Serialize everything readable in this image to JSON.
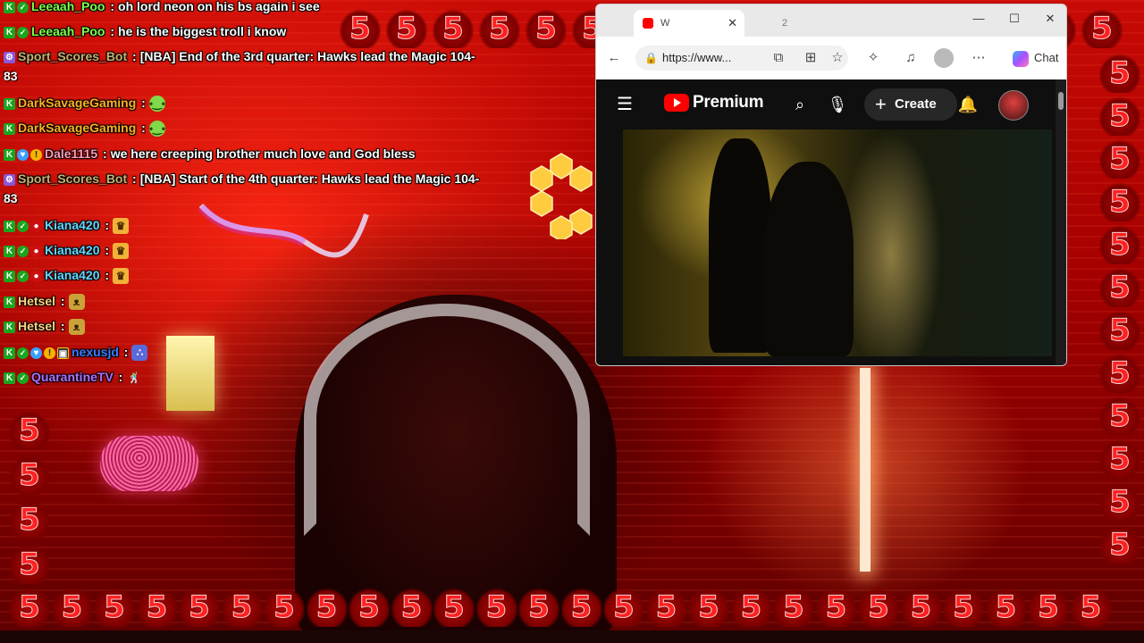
{
  "stream": {
    "border_glyph": "5",
    "chat": [
      {
        "badges": [
          "k-badge",
          "check-badge"
        ],
        "user": "Leeaah_Poo",
        "user_color": "#7dff4a",
        "text": "oh lord neon on his bs again i see"
      },
      {
        "badges": [
          "k-badge",
          "check-badge"
        ],
        "user": "Leeaah_Poo",
        "user_color": "#7dff4a",
        "text": "he is the biggest troll i know"
      },
      {
        "badges": [
          "bot-badge"
        ],
        "user": "Sport_Scores_Bot",
        "user_color": "#c8b070",
        "text": "[NBA] End of the 3rd quarter: Hawks lead the Magic 104-",
        "cont": "83"
      },
      {
        "badges": [
          "k-badge"
        ],
        "user": "DarkSavageGaming",
        "user_color": "#ffb020",
        "emote": "slime-emote"
      },
      {
        "badges": [
          "k-badge"
        ],
        "user": "DarkSavageGaming",
        "user_color": "#ffb020",
        "emote": "slime-emote"
      },
      {
        "badges": [
          "k-badge",
          "heart-badge",
          "gold-badge"
        ],
        "user": "Dale1115",
        "user_color": "#ff9ab8",
        "text": "we here creeping brother much love and God bless"
      },
      {
        "badges": [
          "bot-badge"
        ],
        "user": "Sport_Scores_Bot",
        "user_color": "#c8b070",
        "text": "[NBA] Start of the 4th quarter: Hawks lead the Magic 104-",
        "cont": "83"
      },
      {
        "badges": [
          "k-badge",
          "check-badge",
          "red-badge"
        ],
        "user": "Kiana420",
        "user_color": "#60d8ff",
        "emote": "crown-emote"
      },
      {
        "badges": [
          "k-badge",
          "check-badge",
          "red-badge"
        ],
        "user": "Kiana420",
        "user_color": "#60d8ff",
        "emote": "crown-emote"
      },
      {
        "badges": [
          "k-badge",
          "check-badge",
          "red-badge"
        ],
        "user": "Kiana420",
        "user_color": "#60d8ff",
        "emote": "crown-emote"
      },
      {
        "badges": [
          "k-badge"
        ],
        "user": "Hetsel",
        "user_color": "#ffd080",
        "emote": "cat-emote"
      },
      {
        "badges": [
          "k-badge"
        ],
        "user": "Hetsel",
        "user_color": "#ffd080",
        "emote": "cat-emote"
      },
      {
        "badges": [
          "k-badge",
          "check-badge",
          "heart-badge",
          "gold-badge",
          "box-badge"
        ],
        "user": "nexusjd",
        "user_color": "#3a7bff",
        "emote": "dots-emote"
      },
      {
        "badges": [
          "k-badge",
          "check-badge"
        ],
        "user": "QuarantineTV",
        "user_color": "#b070ff",
        "emote": "dance-emote"
      }
    ]
  },
  "browser": {
    "tab_active": "W",
    "tab_inactive": "2",
    "address": "https://www...",
    "chat_label": "Chat",
    "icons": [
      "back-arrow-icon",
      "lock-icon",
      "extensions-icon",
      "apps-icon",
      "favorite-star-icon",
      "puzzle-icon",
      "music-icon",
      "profile-icon",
      "more-icon",
      "copilot-icon"
    ]
  },
  "youtube": {
    "brand": "Premium",
    "create_label": "Create",
    "colors": {
      "red": "#ff0000",
      "bg": "#0f0f0f"
    }
  }
}
